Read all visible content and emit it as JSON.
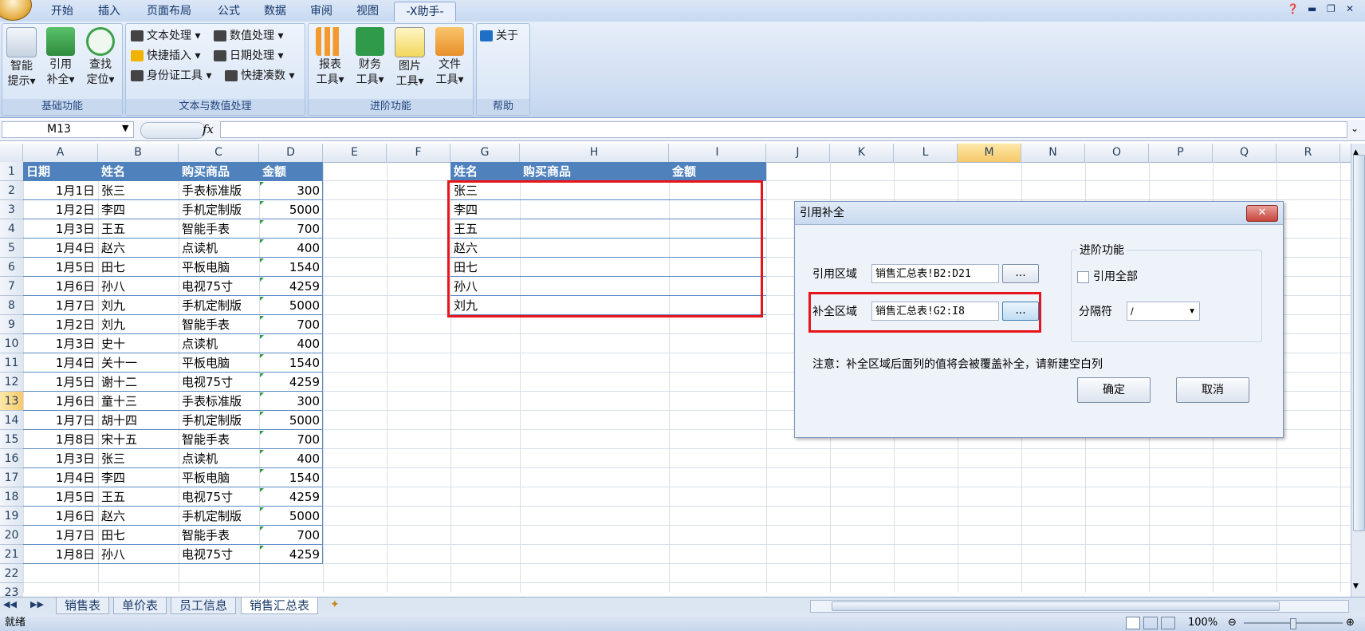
{
  "menu": {
    "tabs": [
      "开始",
      "插入",
      "页面布局",
      "公式",
      "数据",
      "审阅",
      "视图",
      "-X助手-"
    ],
    "active_tab": "-X助手-"
  },
  "ribbon": {
    "groups": [
      {
        "label": "基础功能",
        "buttons": [
          {
            "l1": "智能",
            "l2": "提示▾"
          },
          {
            "l1": "引用",
            "l2": "补全▾"
          },
          {
            "l1": "查找",
            "l2": "定位▾"
          }
        ]
      },
      {
        "label": "文本与数值处理",
        "small": [
          "文本处理 ▾",
          "数值处理 ▾",
          "快捷插入 ▾",
          "日期处理 ▾",
          "身份证工具 ▾",
          "快捷凑数 ▾"
        ]
      },
      {
        "label": "进阶功能",
        "buttons": [
          {
            "l1": "报表",
            "l2": "工具▾"
          },
          {
            "l1": "财务",
            "l2": "工具▾"
          },
          {
            "l1": "图片",
            "l2": "工具▾"
          },
          {
            "l1": "文件",
            "l2": "工具▾"
          }
        ]
      },
      {
        "label": "帮助",
        "small": [
          "关于"
        ]
      }
    ]
  },
  "formula_bar": {
    "name_box": "M13",
    "fx": "fx",
    "formula": ""
  },
  "columns": [
    "A",
    "B",
    "C",
    "D",
    "E",
    "F",
    "G",
    "H",
    "I",
    "J",
    "K",
    "L",
    "M",
    "N",
    "O",
    "P",
    "Q",
    "R"
  ],
  "selected_column": "M",
  "selected_row": "13",
  "rows": [
    "1",
    "2",
    "3",
    "4",
    "5",
    "6",
    "7",
    "8",
    "9",
    "10",
    "11",
    "12",
    "13",
    "14",
    "15",
    "16",
    "17",
    "18",
    "19",
    "20",
    "21",
    "22",
    "23"
  ],
  "table1": {
    "headers": [
      "日期",
      "姓名",
      "购买商品",
      "金额"
    ],
    "rows": [
      [
        "1月1日",
        "张三",
        "手表标准版",
        "300"
      ],
      [
        "1月2日",
        "李四",
        "手机定制版",
        "5000"
      ],
      [
        "1月3日",
        "王五",
        "智能手表",
        "700"
      ],
      [
        "1月4日",
        "赵六",
        "点读机",
        "400"
      ],
      [
        "1月5日",
        "田七",
        "平板电脑",
        "1540"
      ],
      [
        "1月6日",
        "孙八",
        "电视75寸",
        "4259"
      ],
      [
        "1月7日",
        "刘九",
        "手机定制版",
        "5000"
      ],
      [
        "1月2日",
        "刘九",
        "智能手表",
        "700"
      ],
      [
        "1月3日",
        "史十",
        "点读机",
        "400"
      ],
      [
        "1月4日",
        "关十一",
        "平板电脑",
        "1540"
      ],
      [
        "1月5日",
        "谢十二",
        "电视75寸",
        "4259"
      ],
      [
        "1月6日",
        "童十三",
        "手表标准版",
        "300"
      ],
      [
        "1月7日",
        "胡十四",
        "手机定制版",
        "5000"
      ],
      [
        "1月8日",
        "宋十五",
        "智能手表",
        "700"
      ],
      [
        "1月3日",
        "张三",
        "点读机",
        "400"
      ],
      [
        "1月4日",
        "李四",
        "平板电脑",
        "1540"
      ],
      [
        "1月5日",
        "王五",
        "电视75寸",
        "4259"
      ],
      [
        "1月6日",
        "赵六",
        "手机定制版",
        "5000"
      ],
      [
        "1月7日",
        "田七",
        "智能手表",
        "700"
      ],
      [
        "1月8日",
        "孙八",
        "电视75寸",
        "4259"
      ]
    ]
  },
  "table2": {
    "headers": [
      "姓名",
      "购买商品",
      "金额"
    ],
    "names": [
      "张三",
      "李四",
      "王五",
      "赵六",
      "田七",
      "孙八",
      "刘九"
    ]
  },
  "dialog": {
    "title": "引用补全",
    "close": "✕",
    "ref_label": "引用区域",
    "ref_value": "销售汇总表!B2:D21",
    "fill_label": "补全区域",
    "fill_value": "销售汇总表!G2:I8",
    "browse": "...",
    "advanced_title": "进阶功能",
    "ref_all_label": "引用全部",
    "ref_all_checked": false,
    "sep_label": "分隔符",
    "sep_value": "/",
    "note": "注意：补全区域后面列的值将会被覆盖补全，请新建空白列",
    "ok": "确定",
    "cancel": "取消"
  },
  "sheets": [
    "销售表",
    "单价表",
    "员工信息",
    "销售汇总表"
  ],
  "active_sheet": "销售汇总表",
  "status": {
    "mode": "就绪",
    "zoom": "100%"
  },
  "colors": {
    "header_blue": "#4f81bd",
    "highlight_red": "#e8141c",
    "selected": "#f7c86a"
  }
}
